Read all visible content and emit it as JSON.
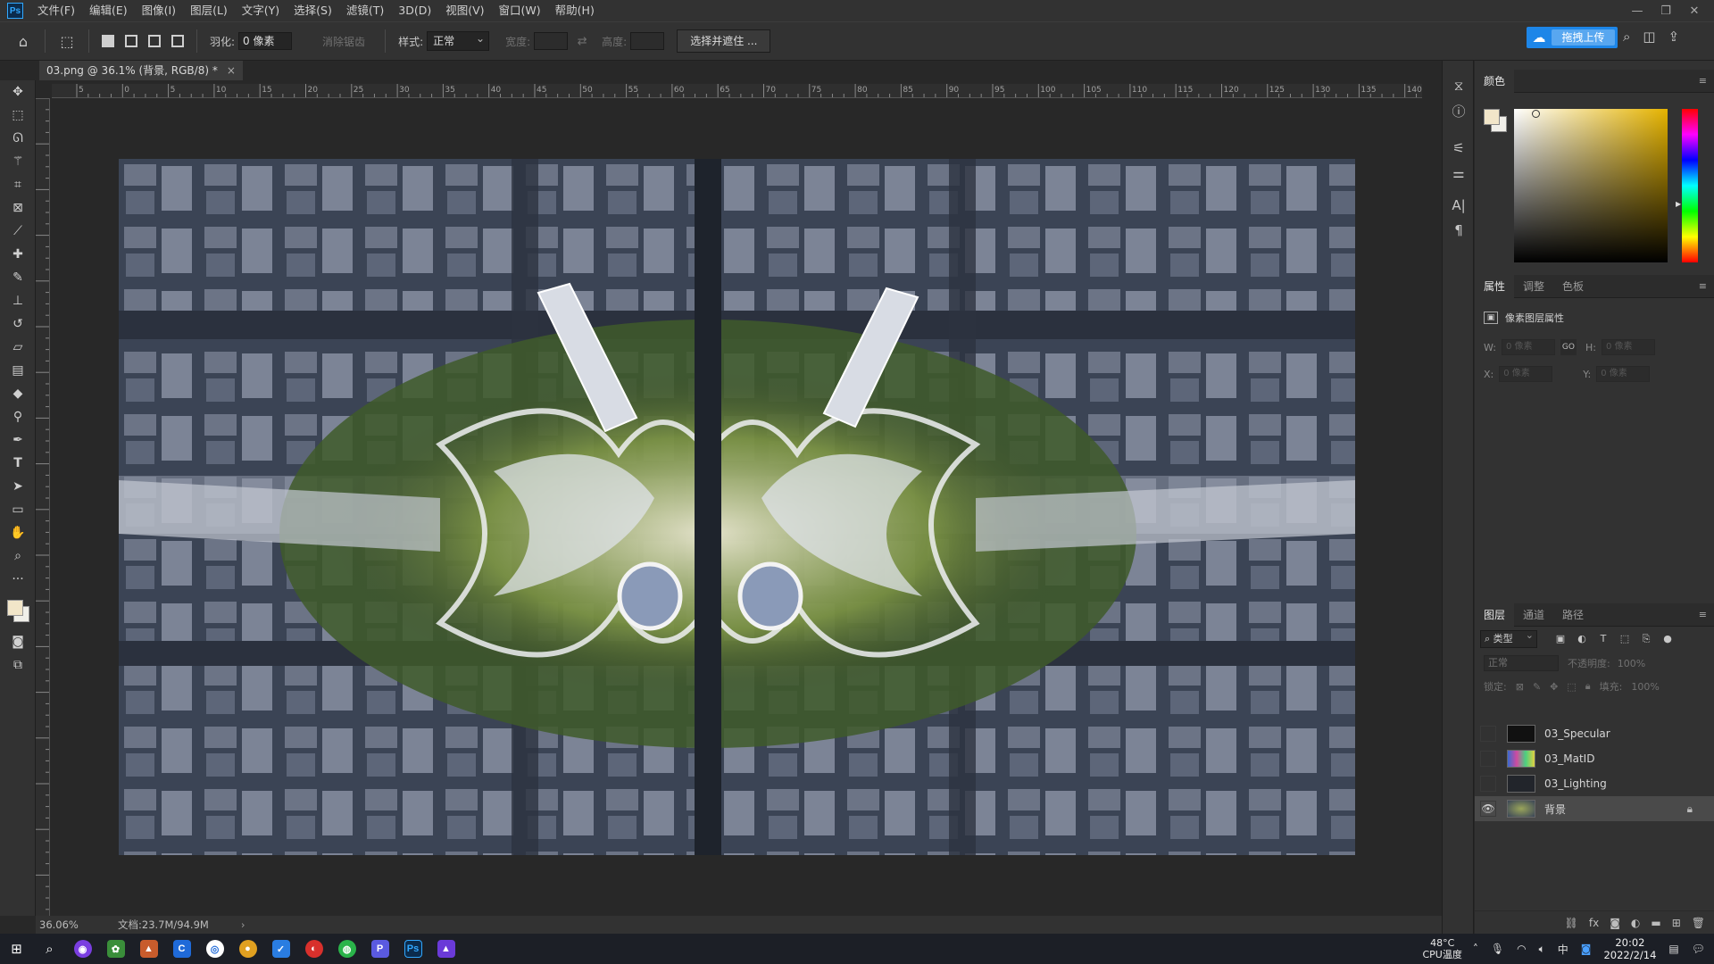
{
  "app": {
    "logo": "Ps"
  },
  "menu": [
    "文件(F)",
    "编辑(E)",
    "图像(I)",
    "图层(L)",
    "文字(Y)",
    "选择(S)",
    "滤镜(T)",
    "3D(D)",
    "视图(V)",
    "窗口(W)",
    "帮助(H)"
  ],
  "window_controls": [
    "—",
    "❐",
    "✕"
  ],
  "options": {
    "feather_label": "羽化:",
    "feather_value": "0 像素",
    "antialias_label": "消除锯齿",
    "style_label": "样式:",
    "style_value": "正常",
    "width_label": "宽度:",
    "height_label": "高度:",
    "select_mask_button": "选择并遮住 ..."
  },
  "cloud": {
    "upload_label": "拖拽上传"
  },
  "document": {
    "tab_title": "03.png @ 36.1% (背景, RGB/8) *",
    "ruler_marks": [
      "5",
      "0",
      "5",
      "10",
      "15",
      "20",
      "25",
      "30",
      "35",
      "40",
      "45",
      "50",
      "55",
      "60",
      "65",
      "70",
      "75",
      "80",
      "85",
      "90",
      "95",
      "100",
      "105",
      "110",
      "115",
      "120",
      "125",
      "130",
      "135",
      "140"
    ]
  },
  "status": {
    "zoom": "36.06%",
    "doc_size": "文档:23.7M/94.9M",
    "arrow": "›"
  },
  "panels": {
    "color": {
      "tab": "颜色"
    },
    "properties": {
      "tabs": [
        "属性",
        "调整",
        "色板"
      ],
      "title": "像素图层属性",
      "w_label": "W:",
      "w_value": "0 像素",
      "h_label": "H:",
      "h_value": "0 像素",
      "x_label": "X:",
      "x_value": "0 像素",
      "y_label": "Y:",
      "y_value": "0 像素",
      "link_label": "GO"
    },
    "layers": {
      "tabs": [
        "图层",
        "通道",
        "路径"
      ],
      "kind_label": "类型",
      "blend_mode": "正常",
      "opacity_label": "不透明度:",
      "opacity_value": "100%",
      "lock_label": "锁定:",
      "fill_label": "填充:",
      "fill_value": "100%",
      "items": [
        {
          "name": "03_Specular",
          "visible": false
        },
        {
          "name": "03_MatID",
          "visible": false
        },
        {
          "name": "03_Lighting",
          "visible": false
        },
        {
          "name": "背景",
          "visible": true,
          "locked": true
        }
      ]
    }
  },
  "taskbar": {
    "temp_value": "48°C",
    "temp_label": "CPU温度",
    "ime": "中",
    "time": "20:02",
    "date": "2022/2/14"
  }
}
